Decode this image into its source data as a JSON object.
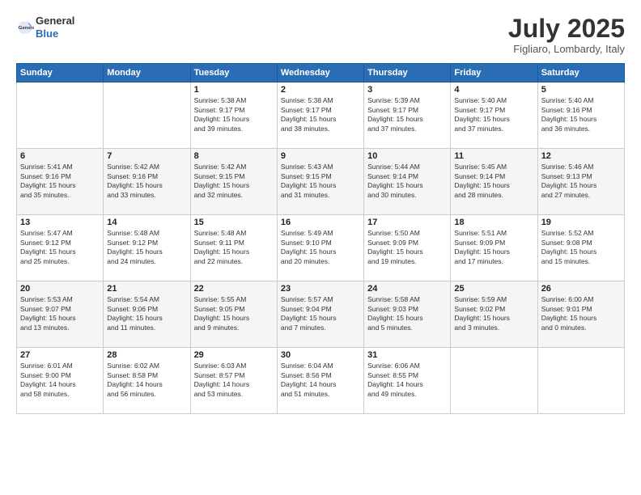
{
  "header": {
    "logo_line1": "General",
    "logo_line2": "Blue",
    "month": "July 2025",
    "location": "Figliaro, Lombardy, Italy"
  },
  "weekdays": [
    "Sunday",
    "Monday",
    "Tuesday",
    "Wednesday",
    "Thursday",
    "Friday",
    "Saturday"
  ],
  "weeks": [
    [
      {
        "day": "",
        "info": ""
      },
      {
        "day": "",
        "info": ""
      },
      {
        "day": "1",
        "info": "Sunrise: 5:38 AM\nSunset: 9:17 PM\nDaylight: 15 hours\nand 39 minutes."
      },
      {
        "day": "2",
        "info": "Sunrise: 5:38 AM\nSunset: 9:17 PM\nDaylight: 15 hours\nand 38 minutes."
      },
      {
        "day": "3",
        "info": "Sunrise: 5:39 AM\nSunset: 9:17 PM\nDaylight: 15 hours\nand 37 minutes."
      },
      {
        "day": "4",
        "info": "Sunrise: 5:40 AM\nSunset: 9:17 PM\nDaylight: 15 hours\nand 37 minutes."
      },
      {
        "day": "5",
        "info": "Sunrise: 5:40 AM\nSunset: 9:16 PM\nDaylight: 15 hours\nand 36 minutes."
      }
    ],
    [
      {
        "day": "6",
        "info": "Sunrise: 5:41 AM\nSunset: 9:16 PM\nDaylight: 15 hours\nand 35 minutes."
      },
      {
        "day": "7",
        "info": "Sunrise: 5:42 AM\nSunset: 9:16 PM\nDaylight: 15 hours\nand 33 minutes."
      },
      {
        "day": "8",
        "info": "Sunrise: 5:42 AM\nSunset: 9:15 PM\nDaylight: 15 hours\nand 32 minutes."
      },
      {
        "day": "9",
        "info": "Sunrise: 5:43 AM\nSunset: 9:15 PM\nDaylight: 15 hours\nand 31 minutes."
      },
      {
        "day": "10",
        "info": "Sunrise: 5:44 AM\nSunset: 9:14 PM\nDaylight: 15 hours\nand 30 minutes."
      },
      {
        "day": "11",
        "info": "Sunrise: 5:45 AM\nSunset: 9:14 PM\nDaylight: 15 hours\nand 28 minutes."
      },
      {
        "day": "12",
        "info": "Sunrise: 5:46 AM\nSunset: 9:13 PM\nDaylight: 15 hours\nand 27 minutes."
      }
    ],
    [
      {
        "day": "13",
        "info": "Sunrise: 5:47 AM\nSunset: 9:12 PM\nDaylight: 15 hours\nand 25 minutes."
      },
      {
        "day": "14",
        "info": "Sunrise: 5:48 AM\nSunset: 9:12 PM\nDaylight: 15 hours\nand 24 minutes."
      },
      {
        "day": "15",
        "info": "Sunrise: 5:48 AM\nSunset: 9:11 PM\nDaylight: 15 hours\nand 22 minutes."
      },
      {
        "day": "16",
        "info": "Sunrise: 5:49 AM\nSunset: 9:10 PM\nDaylight: 15 hours\nand 20 minutes."
      },
      {
        "day": "17",
        "info": "Sunrise: 5:50 AM\nSunset: 9:09 PM\nDaylight: 15 hours\nand 19 minutes."
      },
      {
        "day": "18",
        "info": "Sunrise: 5:51 AM\nSunset: 9:09 PM\nDaylight: 15 hours\nand 17 minutes."
      },
      {
        "day": "19",
        "info": "Sunrise: 5:52 AM\nSunset: 9:08 PM\nDaylight: 15 hours\nand 15 minutes."
      }
    ],
    [
      {
        "day": "20",
        "info": "Sunrise: 5:53 AM\nSunset: 9:07 PM\nDaylight: 15 hours\nand 13 minutes."
      },
      {
        "day": "21",
        "info": "Sunrise: 5:54 AM\nSunset: 9:06 PM\nDaylight: 15 hours\nand 11 minutes."
      },
      {
        "day": "22",
        "info": "Sunrise: 5:55 AM\nSunset: 9:05 PM\nDaylight: 15 hours\nand 9 minutes."
      },
      {
        "day": "23",
        "info": "Sunrise: 5:57 AM\nSunset: 9:04 PM\nDaylight: 15 hours\nand 7 minutes."
      },
      {
        "day": "24",
        "info": "Sunrise: 5:58 AM\nSunset: 9:03 PM\nDaylight: 15 hours\nand 5 minutes."
      },
      {
        "day": "25",
        "info": "Sunrise: 5:59 AM\nSunset: 9:02 PM\nDaylight: 15 hours\nand 3 minutes."
      },
      {
        "day": "26",
        "info": "Sunrise: 6:00 AM\nSunset: 9:01 PM\nDaylight: 15 hours\nand 0 minutes."
      }
    ],
    [
      {
        "day": "27",
        "info": "Sunrise: 6:01 AM\nSunset: 9:00 PM\nDaylight: 14 hours\nand 58 minutes."
      },
      {
        "day": "28",
        "info": "Sunrise: 6:02 AM\nSunset: 8:58 PM\nDaylight: 14 hours\nand 56 minutes."
      },
      {
        "day": "29",
        "info": "Sunrise: 6:03 AM\nSunset: 8:57 PM\nDaylight: 14 hours\nand 53 minutes."
      },
      {
        "day": "30",
        "info": "Sunrise: 6:04 AM\nSunset: 8:56 PM\nDaylight: 14 hours\nand 51 minutes."
      },
      {
        "day": "31",
        "info": "Sunrise: 6:06 AM\nSunset: 8:55 PM\nDaylight: 14 hours\nand 49 minutes."
      },
      {
        "day": "",
        "info": ""
      },
      {
        "day": "",
        "info": ""
      }
    ]
  ]
}
